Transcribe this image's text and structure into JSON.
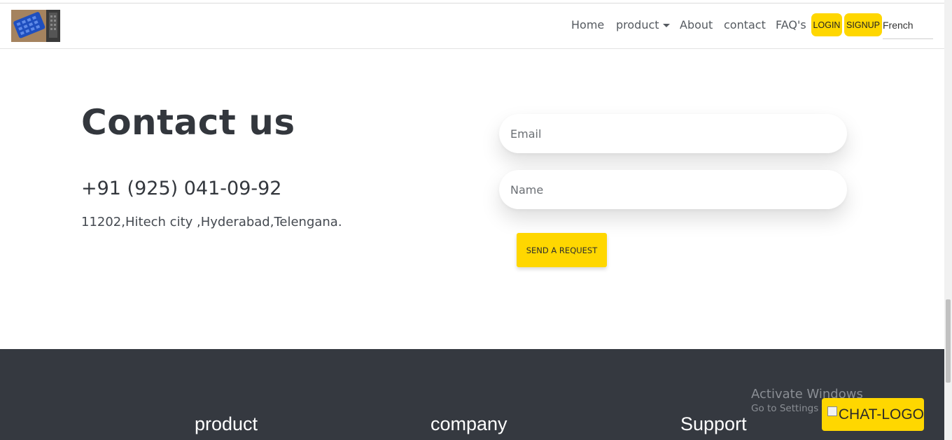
{
  "nav": {
    "home": "Home",
    "product": "product",
    "about": "About",
    "contact": "contact",
    "faq": "FAQ's",
    "login": "LOGIN",
    "signup": "SIGNUP",
    "language": "French"
  },
  "contact": {
    "title": "Contact us",
    "phone": "+91 (925) 041-09-92",
    "address": "11202,Hitech city ,Hyderabad,Telengana.",
    "email_placeholder": "Email",
    "name_placeholder": "Name",
    "send_label": "SEND A REQUEST"
  },
  "footer": {
    "columns": [
      "product",
      "company",
      "Support"
    ]
  },
  "watermark": {
    "line1": "Activate Windows",
    "line2": "Go to Settings to activate Windows."
  },
  "chat": {
    "alt": "CHAT-LOGO"
  },
  "colors": {
    "accent": "#ffd700",
    "footer_bg": "#353940",
    "heading": "#33373d"
  }
}
